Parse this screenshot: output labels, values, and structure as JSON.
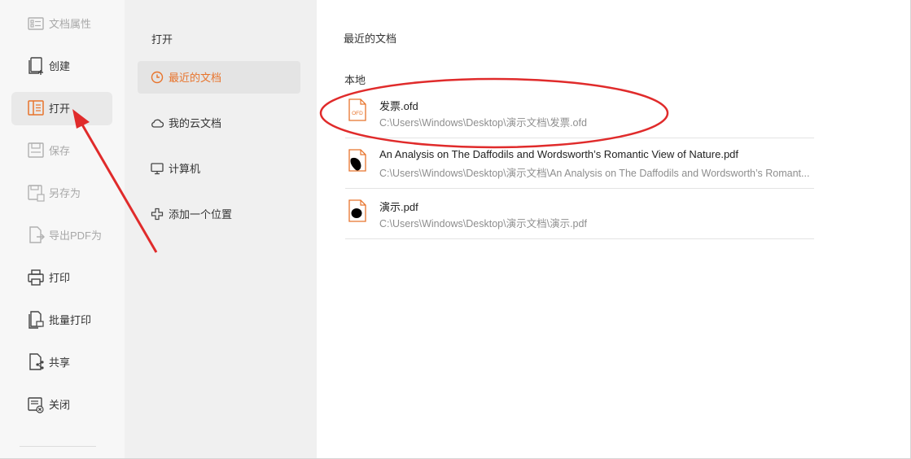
{
  "sidebar": {
    "items": [
      {
        "label": "文档属性",
        "icon": "document-properties-icon",
        "state": "disabled"
      },
      {
        "label": "创建",
        "icon": "create-document-icon",
        "state": "normal"
      },
      {
        "label": "打开",
        "icon": "open-book-icon",
        "state": "active"
      },
      {
        "label": "保存",
        "icon": "save-icon",
        "state": "disabled"
      },
      {
        "label": "另存为",
        "icon": "save-as-icon",
        "state": "disabled"
      },
      {
        "label": "导出PDF为",
        "icon": "export-pdf-icon",
        "state": "disabled"
      },
      {
        "label": "打印",
        "icon": "printer-icon",
        "state": "normal"
      },
      {
        "label": "批量打印",
        "icon": "batch-print-icon",
        "state": "normal"
      },
      {
        "label": "共享",
        "icon": "share-icon",
        "state": "normal"
      },
      {
        "label": "关闭",
        "icon": "close-document-icon",
        "state": "normal"
      }
    ]
  },
  "open_panel": {
    "title": "打开",
    "locations": [
      {
        "label": "最近的文档",
        "icon": "clock-icon",
        "state": "active"
      },
      {
        "label": "我的云文档",
        "icon": "cloud-icon",
        "state": "normal"
      },
      {
        "label": "计算机",
        "icon": "computer-monitor-icon",
        "state": "normal"
      },
      {
        "label": "添加一个位置",
        "icon": "add-location-icon",
        "state": "normal"
      }
    ]
  },
  "recent": {
    "title": "最近的文档",
    "section_label": "本地",
    "files": [
      {
        "name": "发票.ofd",
        "path": "C:\\Users\\Windows\\Desktop\\演示文档\\发票.ofd",
        "icon": "ofd-file-icon",
        "icon_text": "OFD"
      },
      {
        "name": "An Analysis on The Daffodils and Wordsworth’s Romantic View of Nature.pdf",
        "path": "C:\\Users\\Windows\\Desktop\\演示文档\\An Analysis on The Daffodils and Wordsworth’s Romant...",
        "icon": "pdf-file-icon"
      },
      {
        "name": "演示.pdf",
        "path": "C:\\Users\\Windows\\Desktop\\演示文档\\演示.pdf",
        "icon": "pdf-file-icon"
      }
    ]
  },
  "colors": {
    "accent": "#e8742c",
    "annotation_red": "#e02b2b",
    "sidebar_bg": "#f7f7f7",
    "panel_bg": "#f0f0f0"
  }
}
